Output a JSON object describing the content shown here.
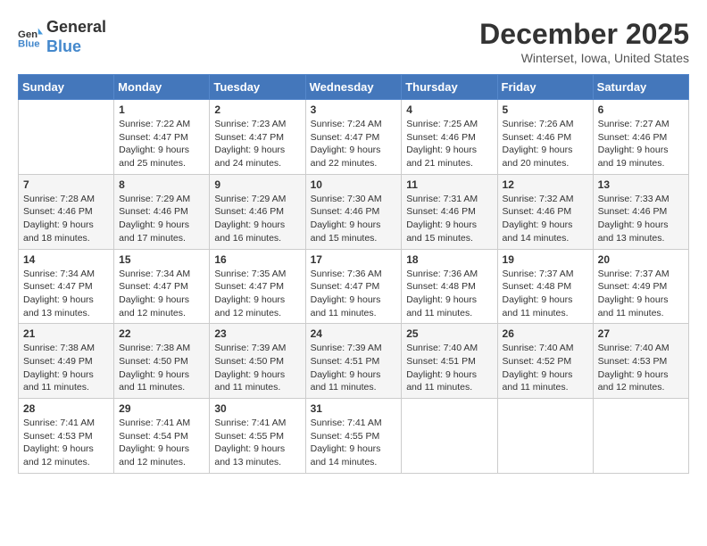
{
  "header": {
    "logo_line1": "General",
    "logo_line2": "Blue",
    "month": "December 2025",
    "location": "Winterset, Iowa, United States"
  },
  "weekdays": [
    "Sunday",
    "Monday",
    "Tuesday",
    "Wednesday",
    "Thursday",
    "Friday",
    "Saturday"
  ],
  "weeks": [
    [
      {
        "day": "",
        "info": ""
      },
      {
        "day": "1",
        "info": "Sunrise: 7:22 AM\nSunset: 4:47 PM\nDaylight: 9 hours\nand 25 minutes."
      },
      {
        "day": "2",
        "info": "Sunrise: 7:23 AM\nSunset: 4:47 PM\nDaylight: 9 hours\nand 24 minutes."
      },
      {
        "day": "3",
        "info": "Sunrise: 7:24 AM\nSunset: 4:47 PM\nDaylight: 9 hours\nand 22 minutes."
      },
      {
        "day": "4",
        "info": "Sunrise: 7:25 AM\nSunset: 4:46 PM\nDaylight: 9 hours\nand 21 minutes."
      },
      {
        "day": "5",
        "info": "Sunrise: 7:26 AM\nSunset: 4:46 PM\nDaylight: 9 hours\nand 20 minutes."
      },
      {
        "day": "6",
        "info": "Sunrise: 7:27 AM\nSunset: 4:46 PM\nDaylight: 9 hours\nand 19 minutes."
      }
    ],
    [
      {
        "day": "7",
        "info": "Sunrise: 7:28 AM\nSunset: 4:46 PM\nDaylight: 9 hours\nand 18 minutes."
      },
      {
        "day": "8",
        "info": "Sunrise: 7:29 AM\nSunset: 4:46 PM\nDaylight: 9 hours\nand 17 minutes."
      },
      {
        "day": "9",
        "info": "Sunrise: 7:29 AM\nSunset: 4:46 PM\nDaylight: 9 hours\nand 16 minutes."
      },
      {
        "day": "10",
        "info": "Sunrise: 7:30 AM\nSunset: 4:46 PM\nDaylight: 9 hours\nand 15 minutes."
      },
      {
        "day": "11",
        "info": "Sunrise: 7:31 AM\nSunset: 4:46 PM\nDaylight: 9 hours\nand 15 minutes."
      },
      {
        "day": "12",
        "info": "Sunrise: 7:32 AM\nSunset: 4:46 PM\nDaylight: 9 hours\nand 14 minutes."
      },
      {
        "day": "13",
        "info": "Sunrise: 7:33 AM\nSunset: 4:46 PM\nDaylight: 9 hours\nand 13 minutes."
      }
    ],
    [
      {
        "day": "14",
        "info": "Sunrise: 7:34 AM\nSunset: 4:47 PM\nDaylight: 9 hours\nand 13 minutes."
      },
      {
        "day": "15",
        "info": "Sunrise: 7:34 AM\nSunset: 4:47 PM\nDaylight: 9 hours\nand 12 minutes."
      },
      {
        "day": "16",
        "info": "Sunrise: 7:35 AM\nSunset: 4:47 PM\nDaylight: 9 hours\nand 12 minutes."
      },
      {
        "day": "17",
        "info": "Sunrise: 7:36 AM\nSunset: 4:47 PM\nDaylight: 9 hours\nand 11 minutes."
      },
      {
        "day": "18",
        "info": "Sunrise: 7:36 AM\nSunset: 4:48 PM\nDaylight: 9 hours\nand 11 minutes."
      },
      {
        "day": "19",
        "info": "Sunrise: 7:37 AM\nSunset: 4:48 PM\nDaylight: 9 hours\nand 11 minutes."
      },
      {
        "day": "20",
        "info": "Sunrise: 7:37 AM\nSunset: 4:49 PM\nDaylight: 9 hours\nand 11 minutes."
      }
    ],
    [
      {
        "day": "21",
        "info": "Sunrise: 7:38 AM\nSunset: 4:49 PM\nDaylight: 9 hours\nand 11 minutes."
      },
      {
        "day": "22",
        "info": "Sunrise: 7:38 AM\nSunset: 4:50 PM\nDaylight: 9 hours\nand 11 minutes."
      },
      {
        "day": "23",
        "info": "Sunrise: 7:39 AM\nSunset: 4:50 PM\nDaylight: 9 hours\nand 11 minutes."
      },
      {
        "day": "24",
        "info": "Sunrise: 7:39 AM\nSunset: 4:51 PM\nDaylight: 9 hours\nand 11 minutes."
      },
      {
        "day": "25",
        "info": "Sunrise: 7:40 AM\nSunset: 4:51 PM\nDaylight: 9 hours\nand 11 minutes."
      },
      {
        "day": "26",
        "info": "Sunrise: 7:40 AM\nSunset: 4:52 PM\nDaylight: 9 hours\nand 11 minutes."
      },
      {
        "day": "27",
        "info": "Sunrise: 7:40 AM\nSunset: 4:53 PM\nDaylight: 9 hours\nand 12 minutes."
      }
    ],
    [
      {
        "day": "28",
        "info": "Sunrise: 7:41 AM\nSunset: 4:53 PM\nDaylight: 9 hours\nand 12 minutes."
      },
      {
        "day": "29",
        "info": "Sunrise: 7:41 AM\nSunset: 4:54 PM\nDaylight: 9 hours\nand 12 minutes."
      },
      {
        "day": "30",
        "info": "Sunrise: 7:41 AM\nSunset: 4:55 PM\nDaylight: 9 hours\nand 13 minutes."
      },
      {
        "day": "31",
        "info": "Sunrise: 7:41 AM\nSunset: 4:55 PM\nDaylight: 9 hours\nand 14 minutes."
      },
      {
        "day": "",
        "info": ""
      },
      {
        "day": "",
        "info": ""
      },
      {
        "day": "",
        "info": ""
      }
    ]
  ]
}
